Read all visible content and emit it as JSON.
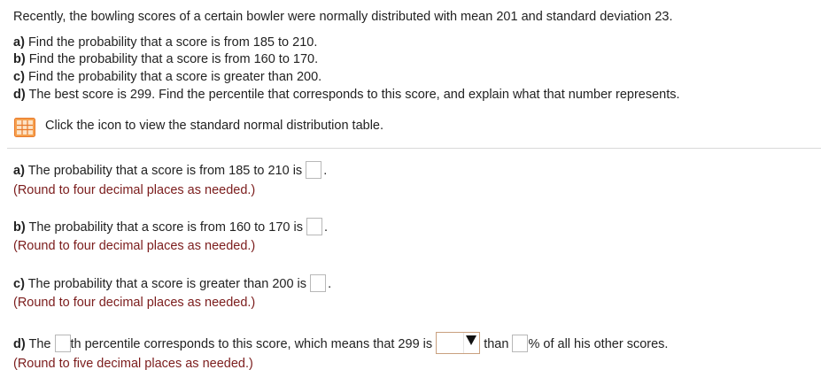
{
  "problem": {
    "intro": "Recently, the bowling scores of a certain bowler were normally distributed with mean 201 and standard deviation 23.",
    "parts": [
      {
        "label": "a)",
        "text": "Find the probability that a score is from 185 to 210."
      },
      {
        "label": "b)",
        "text": "Find the probability that a score is from 160 to 170."
      },
      {
        "label": "c)",
        "text": "Find the probability that a score is greater than 200."
      },
      {
        "label": "d)",
        "text": "The best score is 299. Find the percentile that corresponds to this score, and explain what that number represents."
      }
    ],
    "table_link": "Click the icon to view the standard normal distribution table."
  },
  "answers": {
    "a": {
      "label": "a)",
      "text": "The probability that a score is from 185 to 210 is",
      "note": "(Round to four decimal places as needed.)"
    },
    "b": {
      "label": "b)",
      "text": "The probability that a score is from 160 to 170 is",
      "note": "(Round to four decimal places as needed.)"
    },
    "c": {
      "label": "c)",
      "text": "The probability that a score is greater than 200 is",
      "note": "(Round to four decimal places as needed.)"
    },
    "d": {
      "label": "d)",
      "text_1": "The",
      "text_2": "th percentile corresponds to this score, which means that 299 is",
      "text_3": "than",
      "text_4": "% of all his other scores.",
      "note": "(Round to five decimal places as needed.)"
    }
  },
  "icons": {
    "table": "table-icon",
    "dropdown": "dropdown-arrow-icon"
  },
  "colors": {
    "note": "#7b1c1c",
    "icon": "#e8792b"
  }
}
